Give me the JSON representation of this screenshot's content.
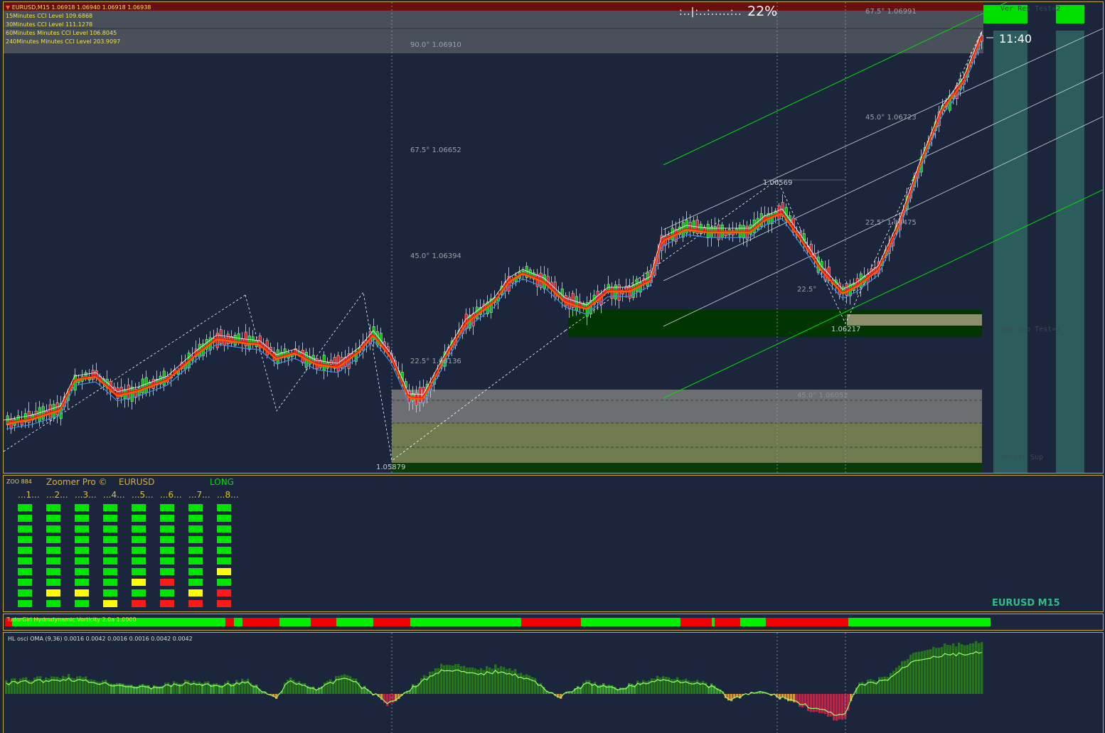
{
  "chart_header": {
    "symbol_line": "EURUSD,M15  1.06918 1.06940 1.06918 1.06938",
    "cci_lines": [
      "15Minutes CCI Level 109.6868",
      "30Minutes CCI Level 111.1278",
      "60Minutes Minutes CCI Level 106.8045",
      "240Minutes Minutes CCI Level 203.9097"
    ]
  },
  "progress": {
    "dots": ":..|:..:.....:..",
    "percent": "22%",
    "value": 0.22
  },
  "clock": "11:40",
  "fib_labels": [
    {
      "text": "67.5° 1.06991"
    },
    {
      "text": "90.0° 1.06910"
    },
    {
      "text": "67.5° 1.06652"
    },
    {
      "text": "45.0° 1.06723"
    },
    {
      "text": "45.0° 1.06394"
    },
    {
      "text": "22.5° 1.06475"
    },
    {
      "text": "22.5° 1.06136"
    },
    {
      "text": "45.0° 1.06052"
    },
    {
      "text": "22.5°"
    }
  ],
  "price_labels": {
    "high": "1.06569",
    "low1": "1.06217",
    "low2": "1.05879"
  },
  "zone_labels": {
    "top": "Ver Res  Test=2",
    "mid": "Ver Sup  Test=1",
    "bottom": "Untest Sup"
  },
  "zoomer": {
    "id": "ZOO 884",
    "name": "Zoomer Pro ©",
    "symbol": "EURUSD",
    "signal": "LONG",
    "columns": [
      "...1...",
      "...2...",
      "...3...",
      "...4...",
      "...5...",
      "...6...",
      "...7...",
      "...8..."
    ],
    "grid": [
      [
        "g",
        "g",
        "g",
        "g",
        "g",
        "g",
        "g",
        "g",
        "g",
        "g"
      ],
      [
        "g",
        "g",
        "g",
        "g",
        "g",
        "g",
        "g",
        "g",
        "y",
        "g"
      ],
      [
        "g",
        "g",
        "g",
        "g",
        "g",
        "g",
        "g",
        "g",
        "y",
        "g"
      ],
      [
        "g",
        "g",
        "g",
        "g",
        "g",
        "g",
        "g",
        "g",
        "g",
        "y"
      ],
      [
        "g",
        "g",
        "g",
        "g",
        "g",
        "g",
        "g",
        "y",
        "g",
        "r"
      ],
      [
        "g",
        "g",
        "g",
        "g",
        "g",
        "g",
        "g",
        "r",
        "g",
        "r"
      ],
      [
        "g",
        "g",
        "g",
        "g",
        "g",
        "g",
        "g",
        "g",
        "y",
        "r"
      ],
      [
        "g",
        "g",
        "g",
        "g",
        "g",
        "g",
        "y",
        "g",
        "r",
        "r"
      ]
    ],
    "timeframe_label": "EURUSD M15"
  },
  "vorticity": {
    "title": "TudorGirl Hydrodynamic Vorticity 2.0a 1.0000",
    "segments": [
      [
        "r",
        10
      ],
      [
        "g",
        300
      ],
      [
        "r",
        12
      ],
      [
        "g",
        12
      ],
      [
        "r",
        52
      ],
      [
        "g",
        44
      ],
      [
        "r",
        36
      ],
      [
        "g",
        52
      ],
      [
        "r",
        52
      ],
      [
        "g",
        156
      ],
      [
        "r",
        84
      ],
      [
        "g",
        140
      ],
      [
        "r",
        44
      ],
      [
        "g",
        4
      ],
      [
        "r",
        36
      ],
      [
        "g",
        36
      ],
      [
        "r",
        116
      ],
      [
        "g",
        200
      ]
    ]
  },
  "oscillator": {
    "title": "HL osci OMA (9,36) 0.0016 0.0042 0.0016 0.0016 0.0042 0.0042"
  },
  "colors": {
    "background": "#1a243a",
    "bull": "#00c800",
    "bear": "#e02020",
    "zoomer_green": "#00e600",
    "zoomer_yellow": "#ffff00",
    "zoomer_red": "#ff1a1a",
    "panel_border": "#c9a82a"
  }
}
